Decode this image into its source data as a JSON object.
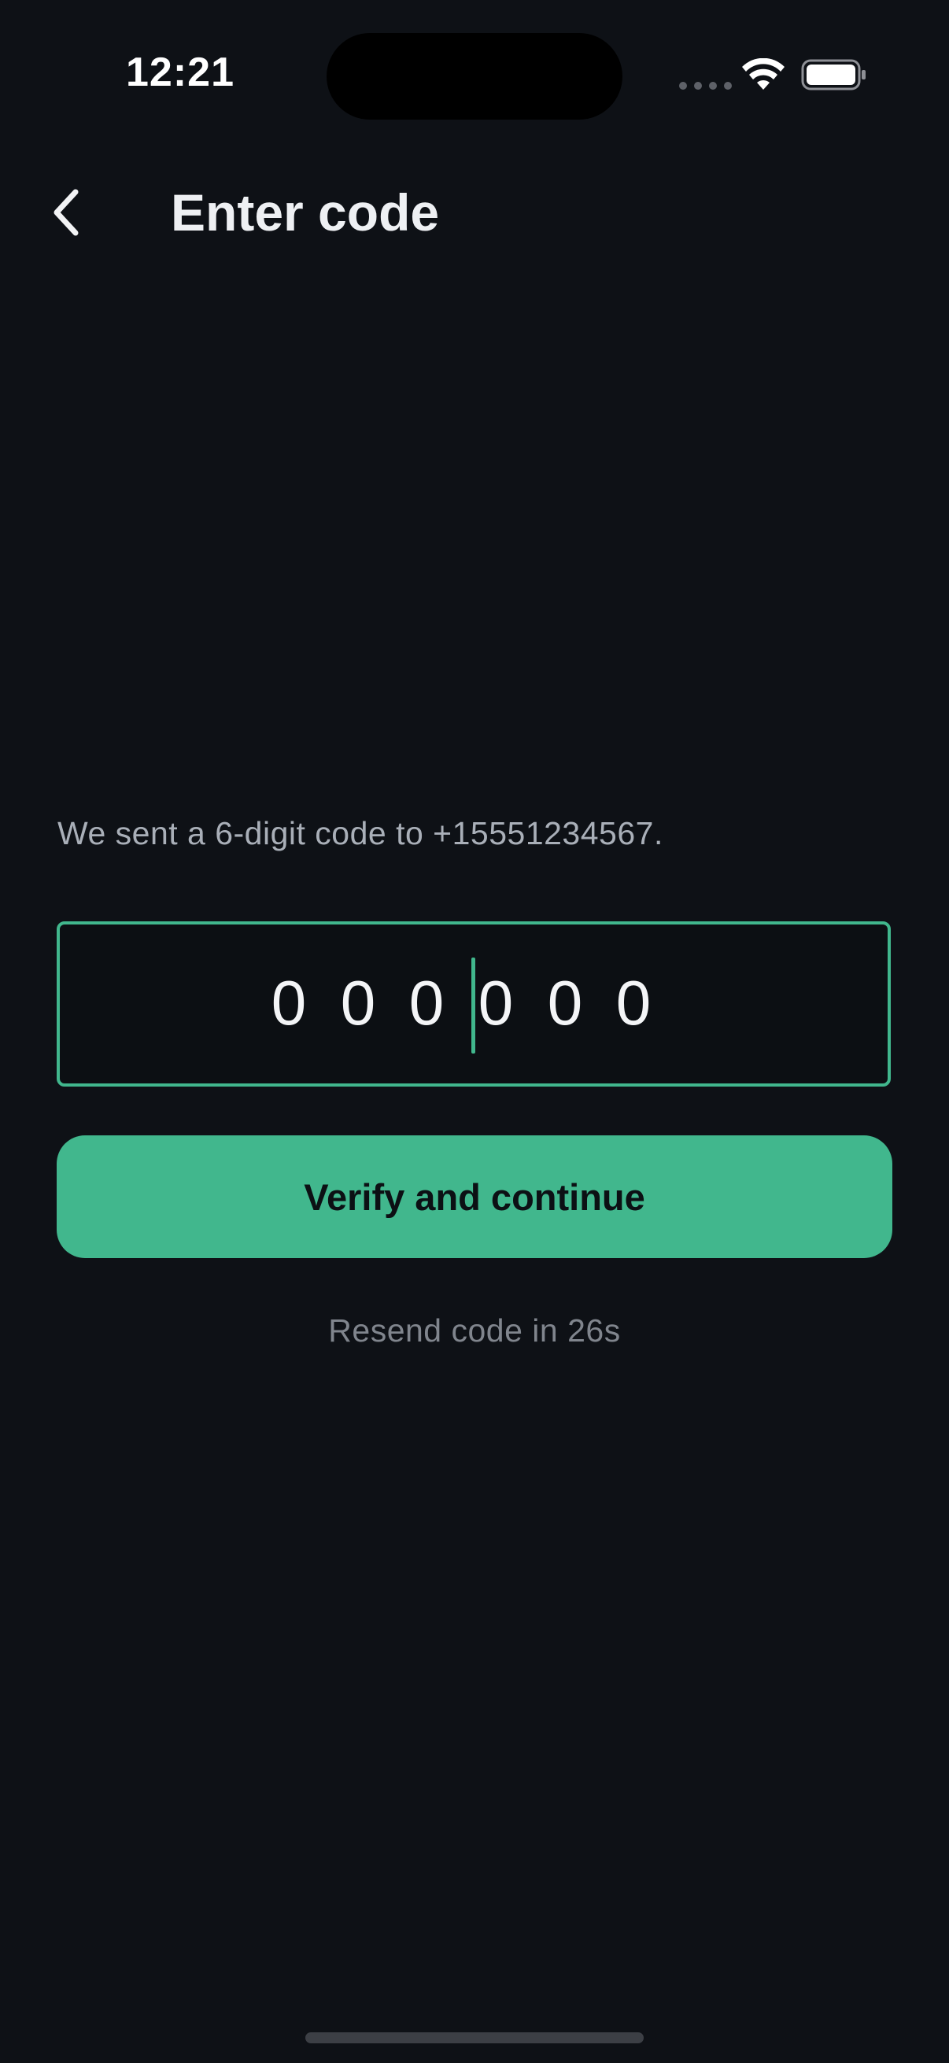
{
  "status_bar": {
    "time": "12:21"
  },
  "header": {
    "back_icon": "chevron-left-icon",
    "title": "Enter code"
  },
  "verification": {
    "message": "We sent a 6-digit code to +15551234567.",
    "code_digits": [
      "0",
      "0",
      "0",
      "0",
      "0",
      "0"
    ],
    "verify_label": "Verify and continue",
    "resend_text": "Resend code in 26s"
  },
  "colors": {
    "background": "#0e1116",
    "accent": "#41b78d",
    "muted_text": "#80858d"
  }
}
